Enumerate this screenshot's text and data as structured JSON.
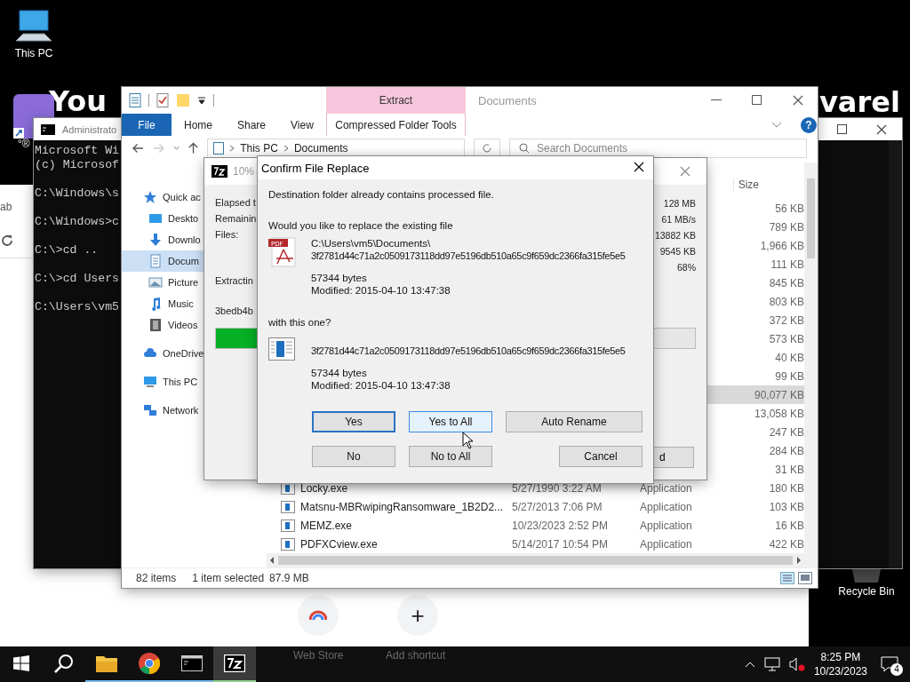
{
  "desktop": {
    "banner": [
      "You",
      "varel"
    ],
    "shortcut_caption": "°®",
    "icons": [
      {
        "label": "This PC",
        "kind": "pc"
      },
      {
        "label": "Recycle Bin",
        "kind": "bin"
      }
    ]
  },
  "browser": {
    "tab_text": "ab",
    "shortcuts": [
      {
        "kind": "store",
        "label": "Web Store"
      },
      {
        "kind": "add",
        "glyph": "+",
        "label": "Add shortcut"
      }
    ]
  },
  "cmd": {
    "title": "Administrato",
    "blocks": [
      [
        "Microsoft Wi",
        "(c) Microsof"
      ],
      [
        "C:\\Windows\\s"
      ],
      [
        "C:\\Windows>c"
      ],
      [
        "C:\\>cd .."
      ],
      [
        "C:\\>cd Users"
      ],
      [
        "C:\\Users\\vm5"
      ]
    ]
  },
  "explorer": {
    "title": "Documents",
    "context_group": "Extract",
    "help": "?",
    "ribbon_tabs": [
      {
        "label": "File",
        "kind": "file"
      },
      {
        "label": "Home",
        "kind": "tab"
      },
      {
        "label": "Share",
        "kind": "tab"
      },
      {
        "label": "View",
        "kind": "tab"
      },
      {
        "label": "Compressed Folder Tools",
        "kind": "context"
      }
    ],
    "path": [
      "This PC",
      "Documents"
    ],
    "search": {
      "placeholder": "Search Documents"
    },
    "nav": [
      {
        "label": "Quick ac",
        "kind": "star",
        "selected": false,
        "children": [
          {
            "label": "Deskto",
            "kind": "desktop",
            "selected": false
          },
          {
            "label": "Downlo",
            "kind": "download",
            "selected": false
          },
          {
            "label": "Docum",
            "kind": "document",
            "selected": true
          },
          {
            "label": "Picture",
            "kind": "picture",
            "selected": false
          },
          {
            "label": "Music",
            "kind": "music",
            "selected": false
          },
          {
            "label": "Videos",
            "kind": "video",
            "selected": false
          }
        ]
      },
      {
        "label": "OneDrive",
        "kind": "cloud",
        "selected": false
      },
      {
        "label": "This PC",
        "kind": "pc",
        "selected": false
      },
      {
        "label": "Network",
        "kind": "network",
        "selected": false
      }
    ],
    "size_header": "Size",
    "rows": [
      {
        "size": "56 KB",
        "selected": false
      },
      {
        "size": "789 KB",
        "selected": false
      },
      {
        "size": "1,966 KB",
        "selected": false
      },
      {
        "size": "111 KB",
        "selected": false
      },
      {
        "size": "845 KB",
        "selected": false
      },
      {
        "size": "803 KB",
        "selected": false
      },
      {
        "size": "372 KB",
        "selected": false
      },
      {
        "size": "573 KB",
        "selected": false
      },
      {
        "size": "40 KB",
        "selected": false
      },
      {
        "size": "99 KB",
        "selected": false
      },
      {
        "size": "90,077 KB",
        "selected": true
      },
      {
        "size": "13,058 KB",
        "selected": false
      },
      {
        "size": "247 KB",
        "selected": false
      },
      {
        "size": "284 KB",
        "selected": false
      },
      {
        "size": "31 KB",
        "selected": false
      },
      {
        "name": "Locky.exe",
        "date": "5/27/1990 3:22 AM",
        "type": "Application",
        "size": "180 KB",
        "selected": false
      },
      {
        "name": "Matsnu-MBRwipingRansomware_1B2D2...",
        "date": "5/27/2013 7:06 PM",
        "type": "Application",
        "size": "103 KB",
        "selected": false
      },
      {
        "name": "MEMZ.exe",
        "date": "10/23/2023 2:52 PM",
        "type": "Application",
        "size": "16 KB",
        "selected": false
      },
      {
        "name": "PDFXCview.exe",
        "date": "5/14/2017 10:54 PM",
        "type": "Application",
        "size": "422 KB",
        "selected": false
      }
    ],
    "status": [
      "82 items",
      "1 item selected",
      "87.9 MB"
    ]
  },
  "extract_progress": {
    "title": "10%",
    "labels": [
      "Elapsed t",
      "Remainin",
      "Files:"
    ],
    "values": [
      "128 MB",
      "61 MB/s",
      "13882 KB",
      "9545 KB",
      "68%"
    ],
    "action": "Extractin",
    "current_file": "3bedb4b",
    "level": 0.09,
    "button": "d"
  },
  "confirm_dialog": {
    "title": "Confirm File Replace",
    "message": "Destination folder already contains processed file.",
    "question": "Would you like to replace the existing file",
    "existing": {
      "kind": "pdf",
      "badge": "PDF",
      "path": "C:\\Users\\vm5\\Documents\\",
      "name": "3f2781d44c71a2c0509173118dd97e5196db510a65c9f659dc2366fa315fe5e5",
      "size": "57344 bytes",
      "modified": "Modified: 2015-04-10 13:47:38"
    },
    "with_text": "with this one?",
    "incoming": {
      "kind": "exe",
      "name": "3f2781d44c71a2c0509173118dd97e5196db510a65c9f659dc2366fa315fe5e5",
      "size": "57344 bytes",
      "modified": "Modified: 2015-04-10 13:47:38"
    },
    "button_rows": [
      [
        {
          "label": "Yes",
          "default": true,
          "hovered": false
        },
        {
          "label": "Yes to All",
          "default": false,
          "hovered": true
        },
        {
          "label": "Auto Rename",
          "default": false,
          "hovered": false,
          "kind": "wide"
        }
      ],
      [
        {
          "label": "No",
          "default": false,
          "hovered": false
        },
        {
          "label": "No to All",
          "default": false,
          "hovered": false
        },
        {
          "label": "Cancel",
          "default": false,
          "hovered": false,
          "kind": "far"
        }
      ]
    ]
  },
  "taskbar": {
    "apps": [
      {
        "kind": "start",
        "open": false,
        "active": false
      },
      {
        "kind": "search",
        "open": false,
        "active": false
      },
      {
        "kind": "folder",
        "open": true,
        "active": false
      },
      {
        "kind": "chrome",
        "open": true,
        "active": false
      },
      {
        "kind": "cmd",
        "open": true,
        "active": false
      },
      {
        "kind": "archiver",
        "open": true,
        "active": true
      }
    ],
    "time": "8:25 PM",
    "date": "10/23/2023",
    "notifications": "4"
  }
}
